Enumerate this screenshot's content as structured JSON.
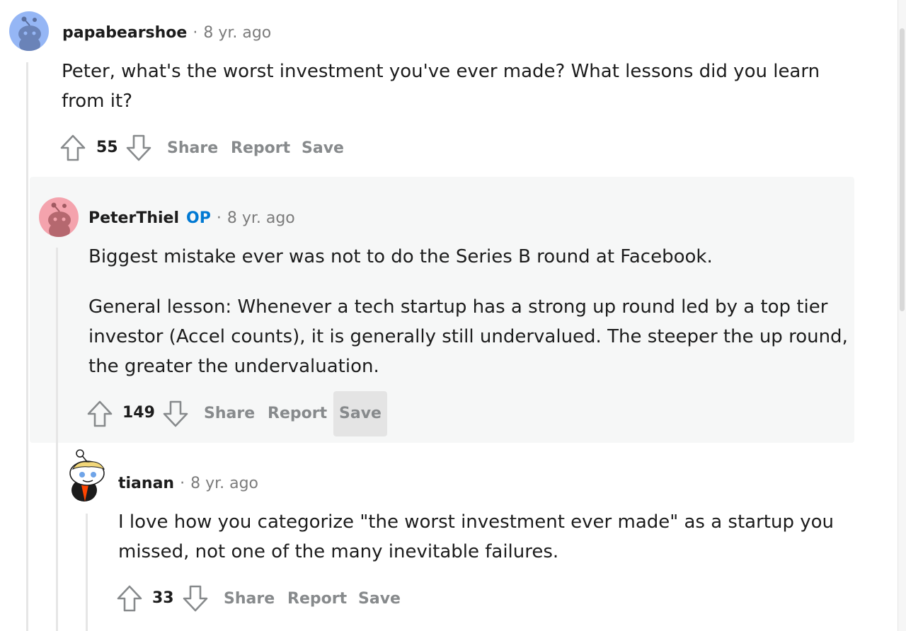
{
  "colors": {
    "op": "#0079d3",
    "muted": "#878a8c",
    "highlight_bg": "#f6f7f7",
    "text": "#1c1c1c"
  },
  "comments": [
    {
      "username": "papabearshoe",
      "separator": "·",
      "timestamp": "8 yr. ago",
      "avatar_icon": "snoo-avatar-blue",
      "body": [
        "Peter, what's the worst investment you've ever made? What lessons did you learn from it?"
      ],
      "score": "55",
      "actions": {
        "share": "Share",
        "report": "Report",
        "save": "Save"
      }
    },
    {
      "username": "PeterThiel",
      "badge": "OP",
      "separator": "·",
      "timestamp": "8 yr. ago",
      "avatar_icon": "snoo-avatar-pink",
      "body": [
        "Biggest mistake ever was not to do the Series B round at Facebook.",
        "General lesson: Whenever a tech startup has a strong up round led by a top tier investor (Accel counts), it is generally still undervalued. The steeper the up round, the greater the undervaluation."
      ],
      "score": "149",
      "actions": {
        "share": "Share",
        "report": "Report",
        "save": "Save"
      },
      "highlighted": true,
      "save_hovered": true
    },
    {
      "username": "tianan",
      "separator": "·",
      "timestamp": "8 yr. ago",
      "avatar_icon": "custom-snoo-avatar",
      "body": [
        "I love how you categorize \"the worst investment ever made\" as a startup you missed, not one of the many inevitable failures."
      ],
      "score": "33",
      "actions": {
        "share": "Share",
        "report": "Report",
        "save": "Save"
      }
    }
  ]
}
